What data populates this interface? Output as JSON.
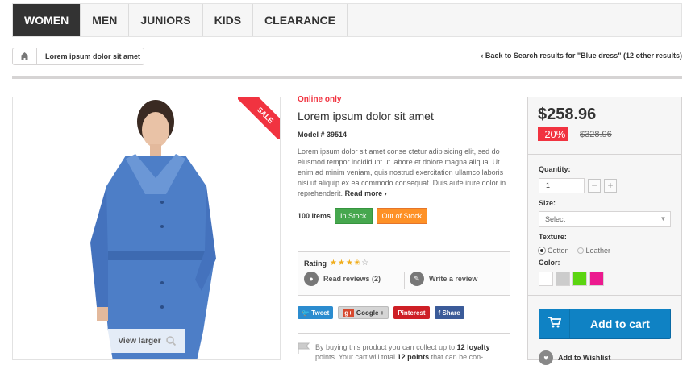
{
  "nav": {
    "items": [
      "Women",
      "Men",
      "Juniors",
      "Kids",
      "Clearance"
    ],
    "active": 0
  },
  "breadcrumb": {
    "current": "Lorem ipsum dolor sit amet"
  },
  "back_link": "Back to Search results for \"Blue dress\" (12 other results)",
  "image": {
    "ribbon": "SALE",
    "view_larger": "View larger"
  },
  "product": {
    "availability_note": "Online only",
    "title": "Lorem ipsum dolor sit amet",
    "model_label": "Model #",
    "model_number": "39514",
    "description": "Lorem ipsum dolor sit amet conse ctetur adipisicing elit, sed do eiusmod tempor incididunt ut labore et dolore magna aliqua. Ut enim ad minim veniam, quis nostrud exercitation ullamco laboris nisi ut aliquip ex ea commodo consequat. Duis aute irure dolor in reprehenderit.",
    "read_more": "Read more",
    "items_count": "100 items",
    "in_stock": "In Stock",
    "out_of_stock": "Out of Stock"
  },
  "rating": {
    "label": "Rating",
    "value": 3.5,
    "max": 5,
    "read_reviews": "Read reviews (2)",
    "write_review": "Write a review"
  },
  "social": {
    "tweet": "Tweet",
    "google": "Google +",
    "pinterest": "Pinterest",
    "facebook": "Share"
  },
  "loyalty": {
    "text_a": "By buying this product you can collect up to ",
    "points": "12 loyalty",
    "text_b": "points. Your cart will total ",
    "points_b": "12 points",
    "text_c": " that can be con-"
  },
  "pricing": {
    "price": "$258.96",
    "discount": "-20%",
    "old_price": "$328.96"
  },
  "options": {
    "quantity_label": "Quantity:",
    "quantity_value": "1",
    "size_label": "Size:",
    "size_selected": "Select",
    "texture_label": "Texture:",
    "textures": [
      "Cotton",
      "Leather"
    ],
    "texture_selected": 0,
    "color_label": "Color:",
    "colors": [
      "#ffffff",
      "#cccccc",
      "#5bd511",
      "#ec1a8f"
    ]
  },
  "actions": {
    "add_to_cart": "Add to cart",
    "wishlist": "Add to Wishlist"
  }
}
